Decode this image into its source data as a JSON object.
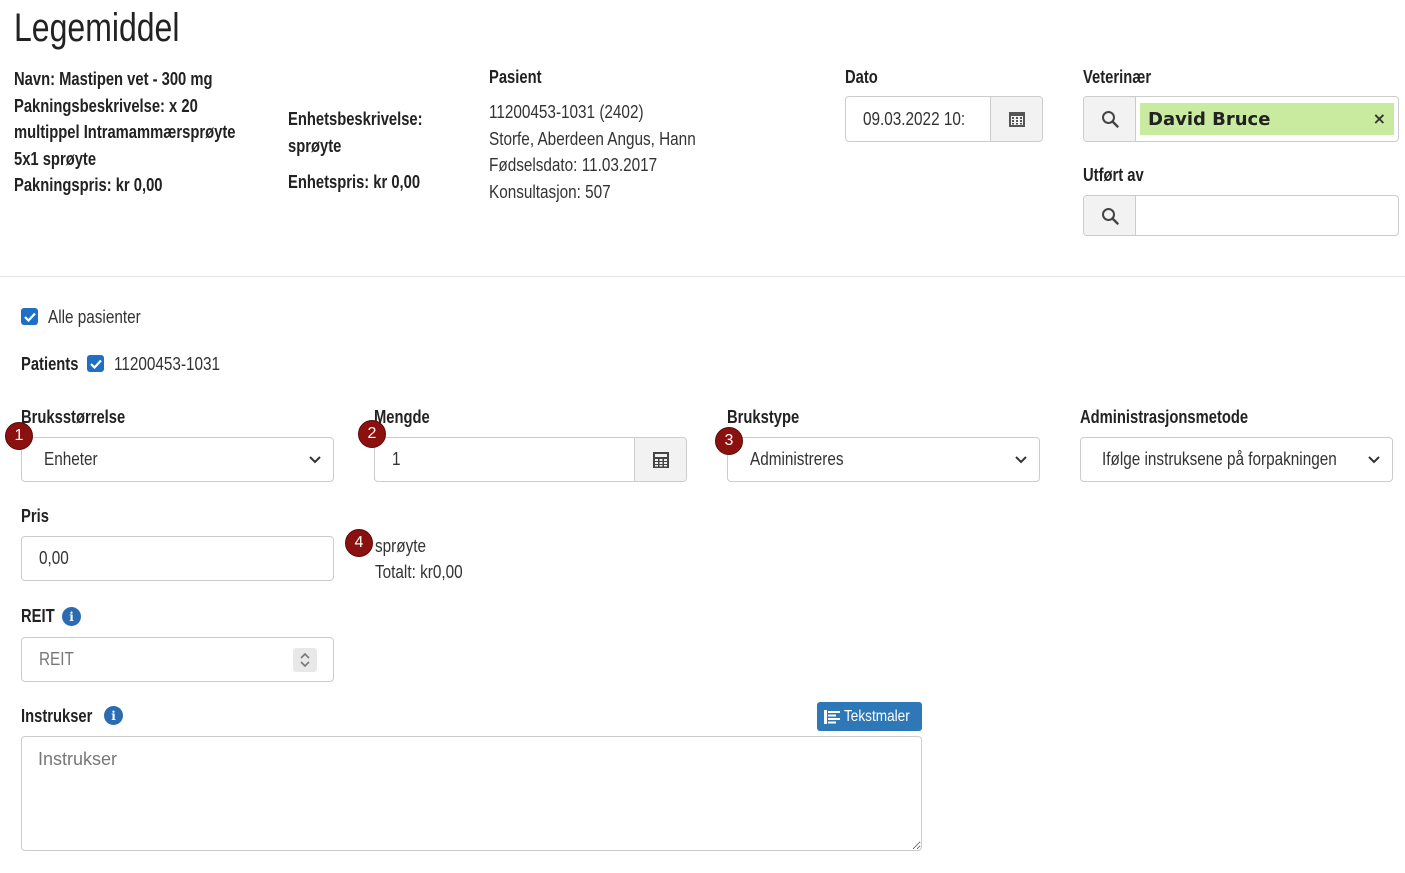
{
  "header": {
    "title": "Legemiddel"
  },
  "product": {
    "name_line": "Navn: Mastipen vet - 300 mg",
    "package_desc_line1": "Pakningsbeskrivelse: x 20",
    "package_desc_line2": "multippel Intramammærsprøyte",
    "package_desc_line3": "5x1 sprøyte",
    "package_price": "Pakningspris: kr 0,00",
    "unit_desc_label": "Enhetsbeskrivelse:",
    "unit_desc_value": "sprøyte",
    "unit_price": "Enhetspris: kr 0,00"
  },
  "patient": {
    "label": "Pasient",
    "id": "11200453-1031 (2402)",
    "species": "Storfe, Aberdeen Angus, Hann",
    "birth": "Fødselsdato: 11.03.2017",
    "consult": "Konsultasjon: 507"
  },
  "date": {
    "label": "Dato",
    "value": "09.03.2022 10:"
  },
  "vet": {
    "label": "Veterinær",
    "selected": "David Bruce",
    "remove": "×"
  },
  "performed_by": {
    "label": "Utført av",
    "value": ""
  },
  "all_patients": {
    "label": "Alle pasienter",
    "checked": true
  },
  "patients": {
    "label": "Patients",
    "id": "11200453-1031",
    "checked": true
  },
  "usage_size": {
    "label": "Bruksstørrelse",
    "value": "Enheter"
  },
  "quantity": {
    "label": "Mengde",
    "value": "1"
  },
  "usage_type": {
    "label": "Brukstype",
    "value": "Administreres"
  },
  "admin_method": {
    "label": "Administrasjonsmetode",
    "value": "Ifølge instruksene på forpakningen"
  },
  "price": {
    "label": "Pris",
    "value": "0,00",
    "unit": "sprøyte",
    "total": "Totalt: kr0,00"
  },
  "reit": {
    "label": "REIT",
    "placeholder": "REIT"
  },
  "instructions": {
    "label": "Instrukser",
    "placeholder": "Instrukser",
    "template_button": "Tekstmaler"
  },
  "badges": [
    "1",
    "2",
    "3",
    "4"
  ],
  "colors": {
    "accent": "#1f6fc5",
    "badge": "#8b1111",
    "vet_tag": "#c8eba0",
    "button": "#2f78b7"
  }
}
